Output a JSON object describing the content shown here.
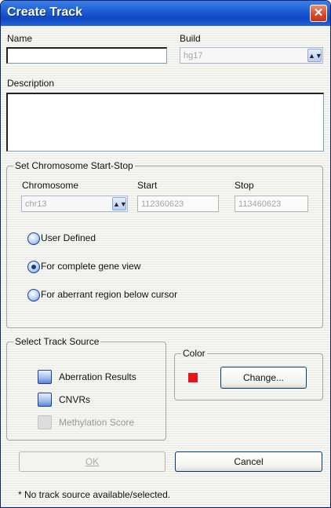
{
  "window": {
    "title": "Create Track",
    "close_label": "✕"
  },
  "name": {
    "label": "Name",
    "value": ""
  },
  "build": {
    "label": "Build",
    "value": "hg17"
  },
  "description": {
    "label": "Description",
    "value": ""
  },
  "chromosome_group": {
    "title": "Set Chromosome Start-Stop",
    "chromosome_label": "Chromosome",
    "chromosome_value": "chr13",
    "start_label": "Start",
    "start_value": "112360623",
    "stop_label": "Stop",
    "stop_value": "113460623"
  },
  "region_options": {
    "selected": "complete_gene_view",
    "items": [
      {
        "id": "user_defined",
        "label": "User Defined"
      },
      {
        "id": "complete_gene_view",
        "label": "For complete gene view"
      },
      {
        "id": "aberrant_region",
        "label": "For aberrant region below cursor"
      }
    ]
  },
  "track_source": {
    "title": "Select Track Source",
    "items": [
      {
        "label": "Aberration Results",
        "enabled": true
      },
      {
        "label": "CNVRs",
        "enabled": true
      },
      {
        "label": "Methylation Score",
        "enabled": false
      }
    ]
  },
  "color_group": {
    "title": "Color",
    "swatch_color": "#e8141c",
    "change_label": "Change..."
  },
  "buttons": {
    "ok_label": "OK",
    "cancel_label": "Cancel"
  },
  "status_text": "* No track source available/selected.",
  "colors": {
    "titlebar": "#1b5bd4",
    "close": "#d8452a",
    "radio_accent": "#1c3f95"
  },
  "icons": {
    "close": "close-icon",
    "dropdown": "chevron-down-icon"
  }
}
